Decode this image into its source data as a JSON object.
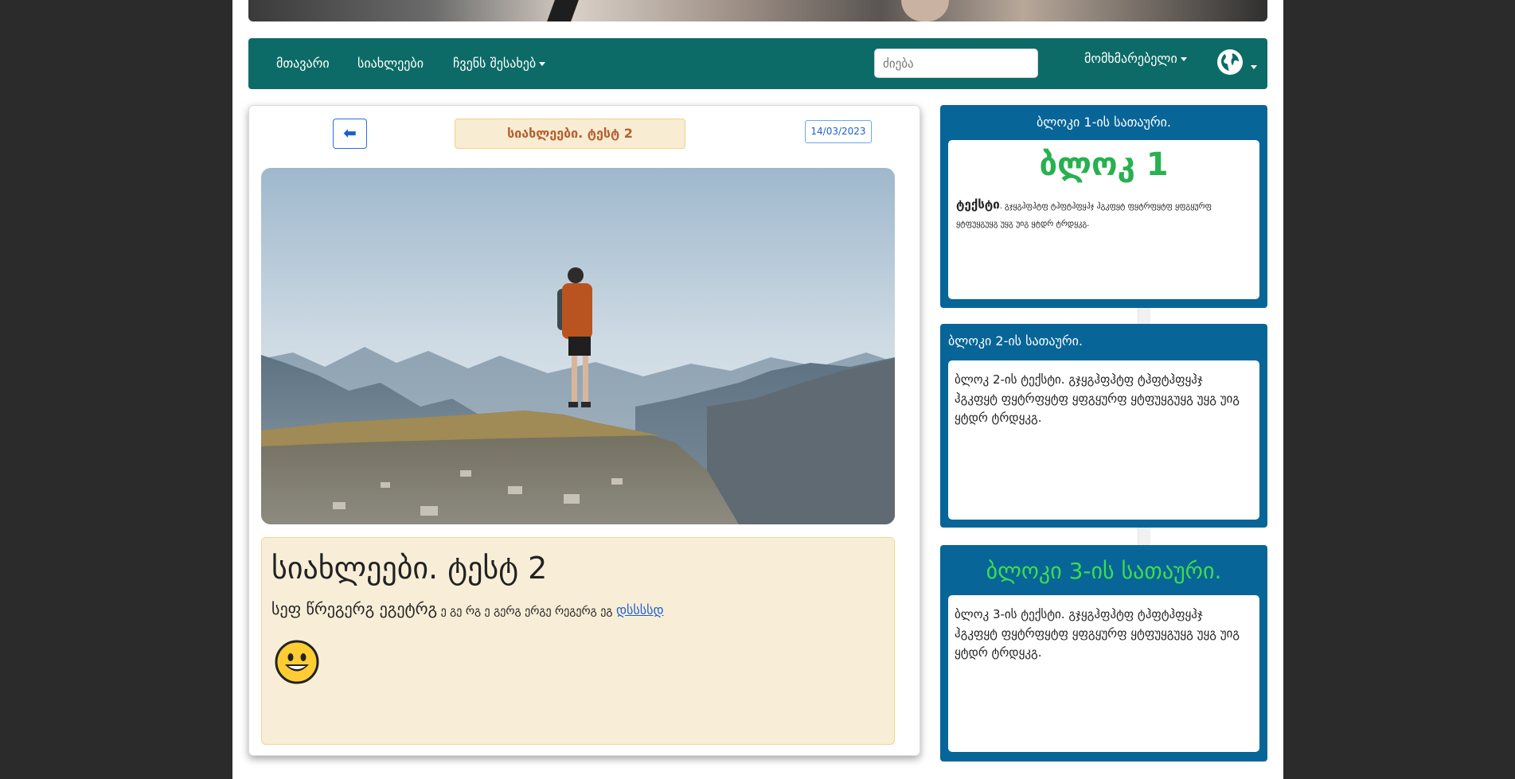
{
  "nav": {
    "home": "მთავარი",
    "news": "სიახლეები",
    "about": "ჩვენს შესახებ",
    "search_placeholder": "ძიება",
    "user": "მომხმარებელი"
  },
  "article": {
    "back_arrow": "⬅",
    "pill_title": "სიახლეები. ტესტ 2",
    "date": "14/03/2023",
    "title": "სიახლეები. ტესტ 2",
    "text_large": "სეფ წრეგერგ ეგეტრგ",
    "text_small": " ე გე რგ ე გერგ ერგე რეგერგ ეგ ",
    "link": "დსსსსდ",
    "emoji": "😀"
  },
  "blocks": [
    {
      "title": "ბლოკი 1-ის სათაური.",
      "big": "ბლოკ 1",
      "bold": "ტექსტი",
      "text": ". გჯყგჰფჰტფ ტჰფტჰფყჰჯ ჰგკფყტ ფყტრფყტფ ყფგყურფ ყტფუყგუყგ უყგ უიგ ყტდრ ტრდყკგ."
    },
    {
      "title": "ბლოკი 2-ის სათაური.",
      "text": "ბლოკ 2-ის ტექსტი. გჯყგჰფჰტფ ტჰფტჰფყჰჯ ჰგკფყტ ფყტრფყტფ ყფგყურფ ყტფუყგუყგ უყგ უიგ ყტდრ ტრდყკგ."
    },
    {
      "title": "ბლოკი 3-ის სათაური.",
      "text": "ბლოკ 3-ის ტექსტი. გჯყგჰფჰტფ ტჰფტჰფყჰჯ ჰგკფყტ ფყტრფყტფ ყფგყურფ ყტფუყგუყგ უყგ უიგ ყტდრ ტრდყკგ."
    }
  ],
  "colors": {
    "navbar": "#0d6b67",
    "block_bg": "#086597",
    "block1_heading": "#27b14f",
    "block3_heading": "#3ddc4f",
    "news_body_bg": "#f8eed8",
    "pill_text": "#b55f2f"
  }
}
